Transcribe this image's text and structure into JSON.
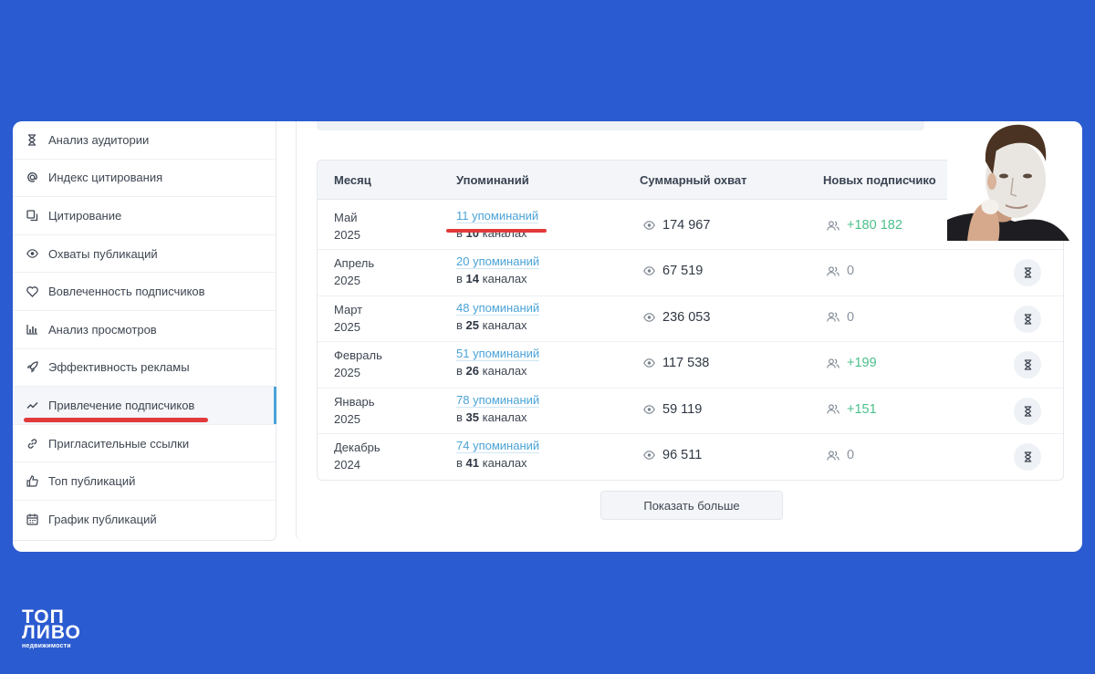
{
  "sidebar": {
    "items": [
      {
        "label": "Анализ аудитории",
        "icon": "hourglass-icon"
      },
      {
        "label": "Индекс цитирования",
        "icon": "at-icon"
      },
      {
        "label": "Цитирование",
        "icon": "copy-icon"
      },
      {
        "label": "Охваты публикаций",
        "icon": "eye-icon"
      },
      {
        "label": "Вовлеченность подписчиков",
        "icon": "heart-icon"
      },
      {
        "label": "Анализ просмотров",
        "icon": "bar-chart-icon"
      },
      {
        "label": "Эффективность рекламы",
        "icon": "rocket-icon"
      },
      {
        "label": "Привлечение подписчиков",
        "icon": "trend-icon"
      },
      {
        "label": "Пригласительные ссылки",
        "icon": "link-icon"
      },
      {
        "label": "Топ публикаций",
        "icon": "thumbs-up-icon"
      },
      {
        "label": "График публикаций",
        "icon": "calendar-icon"
      }
    ],
    "active_index": 7
  },
  "table": {
    "headers": {
      "month": "Месяц",
      "mentions": "Упоминаний",
      "reach": "Суммарный охват",
      "subscribers": "Новых подписчико"
    },
    "rows": [
      {
        "month": "Май",
        "year": "2025",
        "mentions": "11 упоминаний",
        "channels_prefix": "в",
        "channels_count": "10",
        "channels_suffix": "каналах",
        "reach": "174 967",
        "subscribers": "+180 182",
        "positive": true
      },
      {
        "month": "Апрель",
        "year": "2025",
        "mentions": "20 упоминаний",
        "channels_prefix": "в",
        "channels_count": "14",
        "channels_suffix": "каналах",
        "reach": "67 519",
        "subscribers": "0",
        "positive": false
      },
      {
        "month": "Март",
        "year": "2025",
        "mentions": "48 упоминаний",
        "channels_prefix": "в",
        "channels_count": "25",
        "channels_suffix": "каналах",
        "reach": "236 053",
        "subscribers": "0",
        "positive": false
      },
      {
        "month": "Февраль",
        "year": "2025",
        "mentions": "51 упоминаний",
        "channels_prefix": "в",
        "channels_count": "26",
        "channels_suffix": "каналах",
        "reach": "117 538",
        "subscribers": "+199",
        "positive": true
      },
      {
        "month": "Январь",
        "year": "2025",
        "mentions": "78 упоминаний",
        "channels_prefix": "в",
        "channels_count": "35",
        "channels_suffix": "каналах",
        "reach": "59 119",
        "subscribers": "+151",
        "positive": true
      },
      {
        "month": "Декабрь",
        "year": "2024",
        "mentions": "74 упоминаний",
        "channels_prefix": "в",
        "channels_count": "41",
        "channels_suffix": "каналах",
        "reach": "96 511",
        "subscribers": "0",
        "positive": false
      }
    ]
  },
  "show_more_label": "Показать больше",
  "logo": {
    "line1": "ТОП",
    "line2": "ЛИВО",
    "line3": "недвижимости"
  },
  "colors": {
    "background": "#2b5bd0",
    "link": "#4aa3d8",
    "positive": "#4bc08a",
    "highlight": "#e23a3a"
  }
}
